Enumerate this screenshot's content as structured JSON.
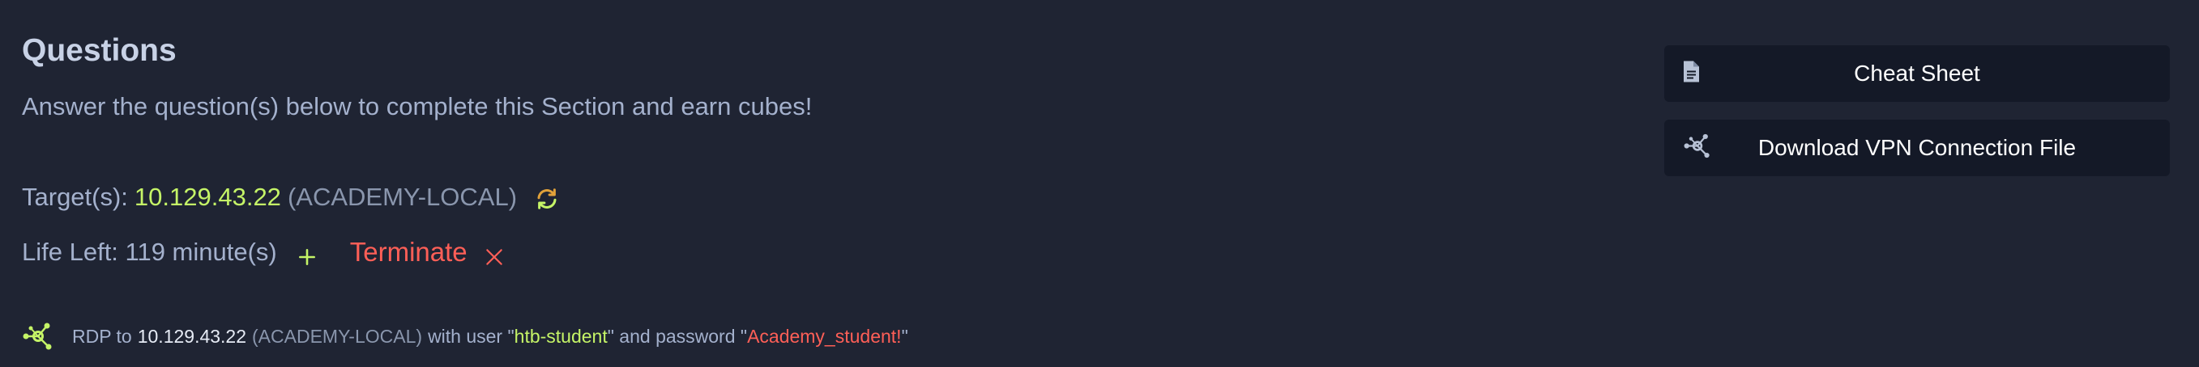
{
  "questions": {
    "title": "Questions",
    "subtitle": "Answer the question(s) below to complete this Section and earn cubes!"
  },
  "target": {
    "label": "Target(s):",
    "ip": "10.129.43.22",
    "host": "(ACADEMY-LOCAL)",
    "refresh_icon": "refresh-icon"
  },
  "life": {
    "label": "Life Left: 119 minute(s)",
    "extend_icon": "plus-icon",
    "terminate_label": "Terminate",
    "terminate_icon": "close-icon"
  },
  "rdp": {
    "icon": "network-icon",
    "prefix": "RDP to",
    "ip": "10.129.43.22",
    "host": "(ACADEMY-LOCAL)",
    "with_user": "with user \"",
    "user": "htb-student",
    "and_password": "\" and password \"",
    "password": "Academy_student!",
    "suffix": "\""
  },
  "sidebar": {
    "cheatsheet_label": "Cheat Sheet",
    "cheatsheet_icon": "document-icon",
    "vpn_label": "Download VPN Connection File",
    "vpn_icon": "network-icon"
  },
  "colors": {
    "background": "#1f2433",
    "button_bg": "#141927",
    "accent_green": "#c5f467",
    "accent_red": "#ff5f57",
    "text_muted": "#a4b1cd"
  }
}
